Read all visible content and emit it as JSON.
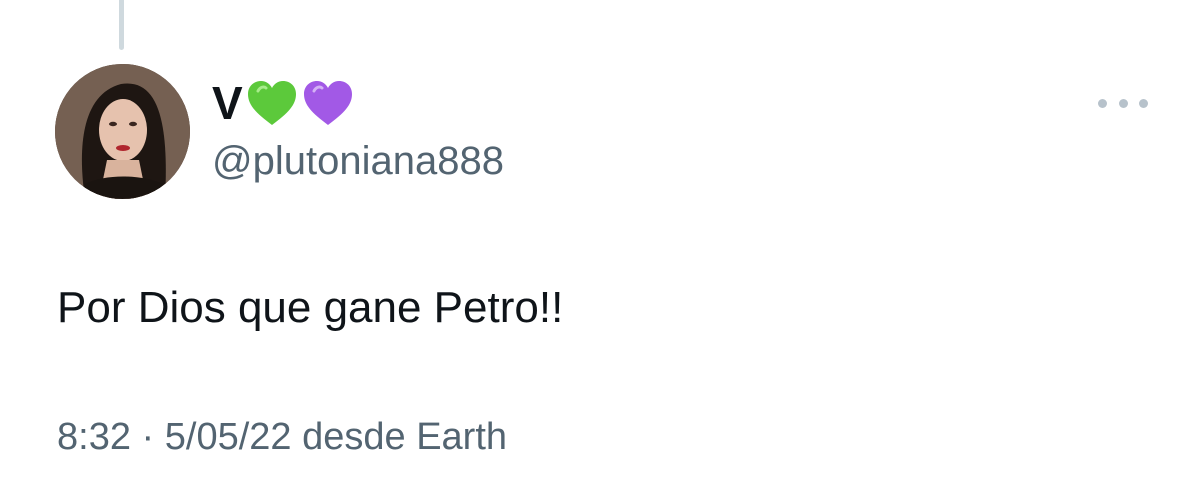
{
  "tweet": {
    "display_name": "V",
    "name_emoji": [
      "green-heart",
      "purple-heart"
    ],
    "handle": "@plutoniana888",
    "text": "Por Dios que gane Petro!!",
    "time": "8:32",
    "separator": "·",
    "date": "5/05/22",
    "source": "desde Earth"
  },
  "colors": {
    "text_primary": "#0f1419",
    "text_secondary": "#536471",
    "thread_line": "#cfd9de",
    "green_heart": "#5cc93b",
    "purple_heart": "#a259e6",
    "more_dots": "#b7c2cb"
  }
}
